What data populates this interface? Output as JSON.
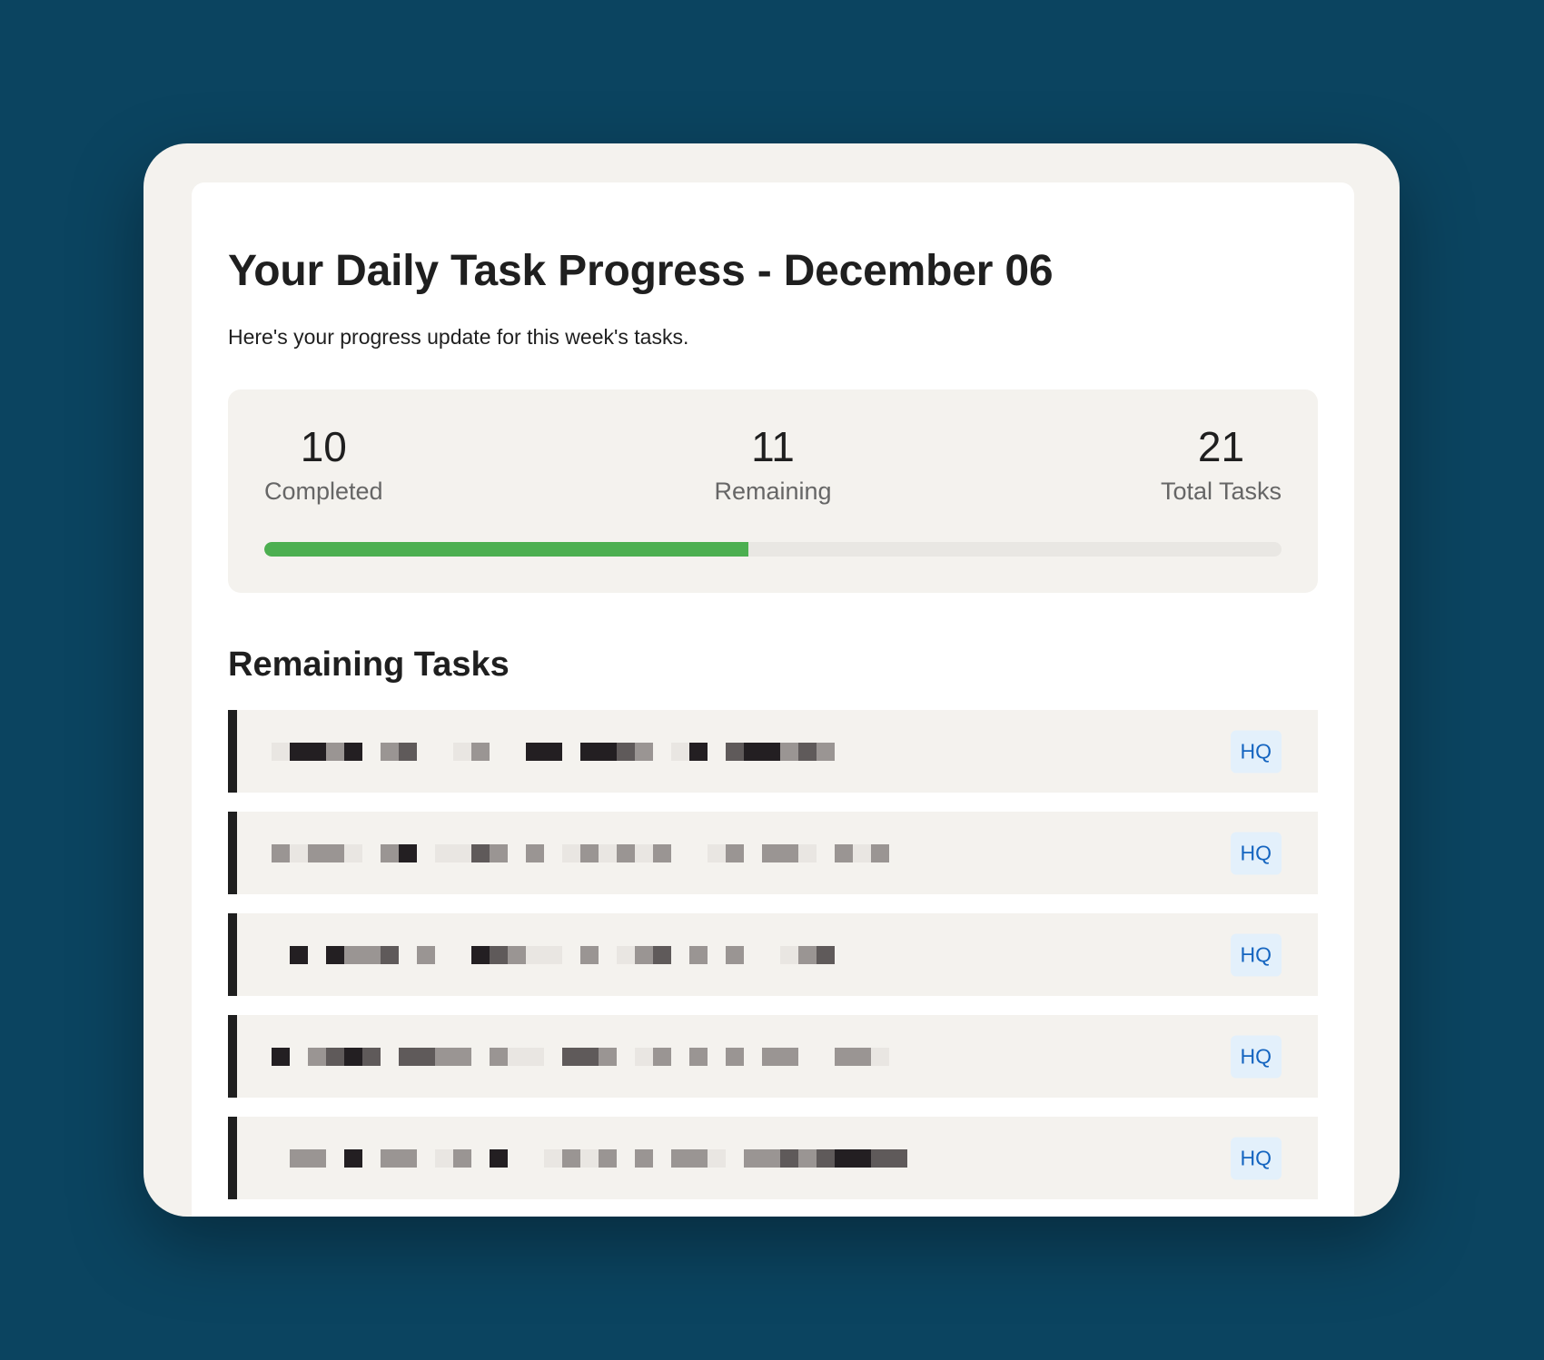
{
  "header": {
    "title": "Your Daily Task Progress - December 06",
    "subtitle": "Here's your progress update for this week's tasks."
  },
  "stats": {
    "completed": {
      "value": "10",
      "label": "Completed"
    },
    "remaining": {
      "value": "11",
      "label": "Remaining"
    },
    "total": {
      "value": "21",
      "label": "Total Tasks"
    },
    "progress_fraction": 0.476
  },
  "remaining_section": {
    "title": "Remaining Tasks",
    "tasks": [
      {
        "text_redacted": true,
        "badge": "HQ"
      },
      {
        "text_redacted": true,
        "badge": "HQ"
      },
      {
        "text_redacted": true,
        "badge": "HQ"
      },
      {
        "text_redacted": true,
        "badge": "HQ"
      },
      {
        "text_redacted": true,
        "badge": "HQ"
      }
    ]
  },
  "colors": {
    "page_background": "#0b4460",
    "progress_fill": "#4caf50",
    "task_accent": "#1f1f1f",
    "badge_text": "#1565c0",
    "badge_background": "#e3f0fb"
  }
}
